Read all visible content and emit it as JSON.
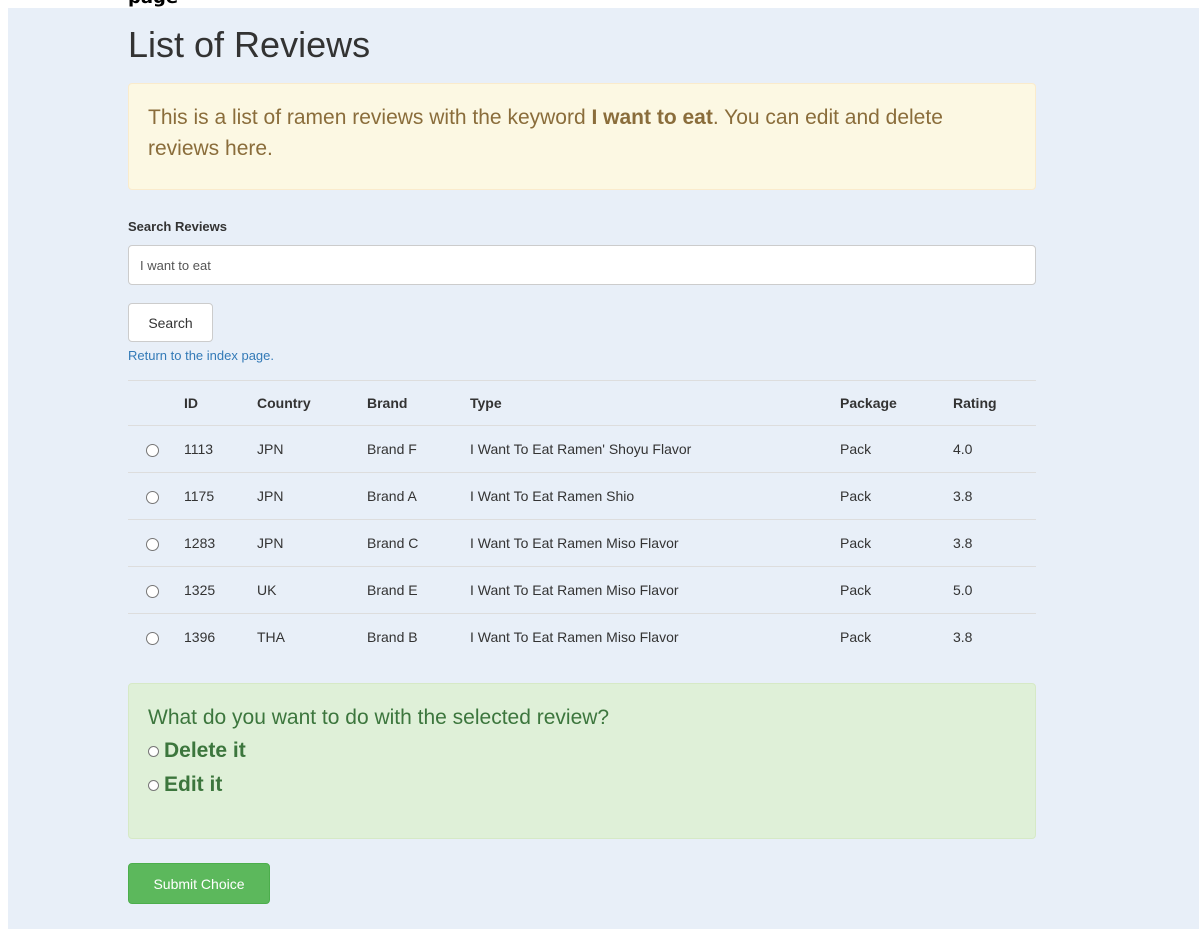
{
  "top_heading_fragment": "page",
  "page_title": "List of Reviews",
  "notice": {
    "prefix": "This is a list of ramen reviews with the keyword ",
    "keyword": "I want to eat",
    "suffix": ". You can edit and delete reviews here."
  },
  "search": {
    "label": "Search Reviews",
    "value": "I want to eat",
    "button_label": "Search"
  },
  "index_link": "Return to the index page.",
  "table": {
    "headers": [
      "",
      "ID",
      "Country",
      "Brand",
      "Type",
      "Package",
      "Rating"
    ],
    "rows": [
      {
        "id": "1113",
        "country": "JPN",
        "brand": "Brand F",
        "type": "I Want To Eat Ramen' Shoyu Flavor",
        "package": "Pack",
        "rating": "4.0"
      },
      {
        "id": "1175",
        "country": "JPN",
        "brand": "Brand A",
        "type": "I Want To Eat Ramen Shio",
        "package": "Pack",
        "rating": "3.8"
      },
      {
        "id": "1283",
        "country": "JPN",
        "brand": "Brand C",
        "type": "I Want To Eat Ramen Miso Flavor",
        "package": "Pack",
        "rating": "3.8"
      },
      {
        "id": "1325",
        "country": "UK",
        "brand": "Brand E",
        "type": "I Want To Eat Ramen Miso Flavor",
        "package": "Pack",
        "rating": "5.0"
      },
      {
        "id": "1396",
        "country": "THA",
        "brand": "Brand B",
        "type": "I Want To Eat Ramen Miso Flavor",
        "package": "Pack",
        "rating": "3.8"
      }
    ]
  },
  "action_box": {
    "question": "What do you want to do with the selected review?",
    "options": [
      "Delete it",
      "Edit it"
    ]
  },
  "submit_label": "Submit Choice",
  "colors": {
    "page_background": "#e8eff8",
    "warning_background": "#fcf8e3",
    "warning_text": "#8a6d3b",
    "success_background": "#dff0d8",
    "success_text": "#3c763d",
    "submit_button": "#5cb85c",
    "link": "#337ab7"
  }
}
